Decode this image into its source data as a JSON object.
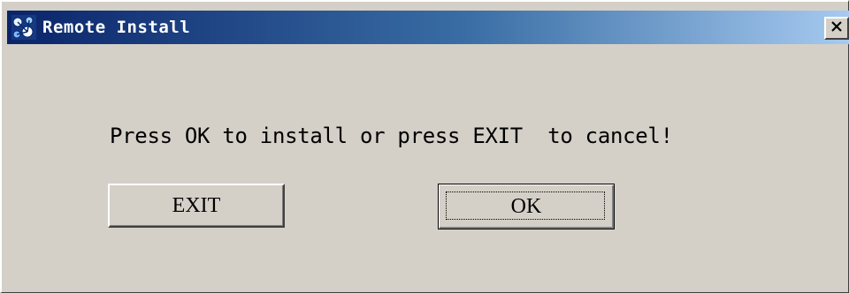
{
  "window": {
    "title": "Remote Install",
    "close_icon": "close-icon"
  },
  "dialog": {
    "message": "Press OK to install or press EXIT  to cancel!",
    "buttons": {
      "exit_label": "EXIT",
      "ok_label": "OK"
    },
    "default_button": "OK"
  },
  "colors": {
    "window_bg": "#d4d0c8",
    "titlebar_start": "#0a246a",
    "titlebar_end": "#a6caf0",
    "title_text": "#ffffff"
  }
}
